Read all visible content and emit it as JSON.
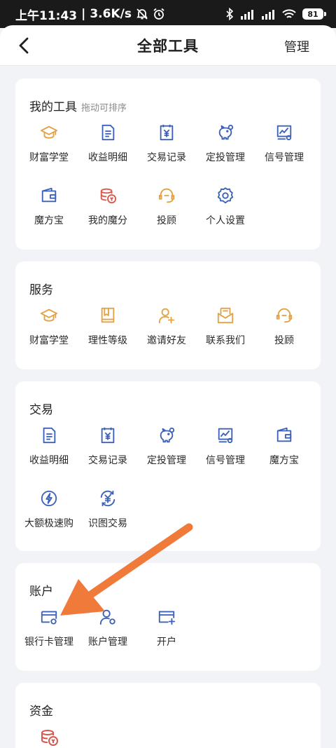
{
  "status_bar": {
    "time": "上午11:43",
    "speed": "3.6K/s",
    "battery": "81"
  },
  "header": {
    "title": "全部工具",
    "manage_label": "管理"
  },
  "sections": [
    {
      "title": "我的工具",
      "subtitle": "拖动可排序",
      "items": [
        {
          "label": "财富学堂",
          "icon": "graduation-cap-icon",
          "color": "#e3a245"
        },
        {
          "label": "收益明细",
          "icon": "document-icon",
          "color": "#3c61b8"
        },
        {
          "label": "交易记录",
          "icon": "yuan-receipt-icon",
          "color": "#3c61b8"
        },
        {
          "label": "定投管理",
          "icon": "piggy-bank-icon",
          "color": "#3c61b8"
        },
        {
          "label": "信号管理",
          "icon": "chart-signal-icon",
          "color": "#3c61b8"
        },
        {
          "label": "魔方宝",
          "icon": "wallet-icon",
          "color": "#3c61b8"
        },
        {
          "label": "我的魔分",
          "icon": "coin-stack-icon",
          "color": "#d9574c"
        },
        {
          "label": "投顾",
          "icon": "headset-icon",
          "color": "#e3a245"
        },
        {
          "label": "个人设置",
          "icon": "gear-icon",
          "color": "#3c61b8"
        }
      ]
    },
    {
      "title": "服务",
      "items": [
        {
          "label": "财富学堂",
          "icon": "graduation-cap-icon",
          "color": "#e3a245"
        },
        {
          "label": "理性等级",
          "icon": "book-icon",
          "color": "#e3a245"
        },
        {
          "label": "邀请好友",
          "icon": "add-user-icon",
          "color": "#e3a245"
        },
        {
          "label": "联系我们",
          "icon": "envelope-icon",
          "color": "#e3a245"
        },
        {
          "label": "投顾",
          "icon": "headset-icon",
          "color": "#e3a245"
        }
      ]
    },
    {
      "title": "交易",
      "items": [
        {
          "label": "收益明细",
          "icon": "document-icon",
          "color": "#3c61b8"
        },
        {
          "label": "交易记录",
          "icon": "yuan-receipt-icon",
          "color": "#3c61b8"
        },
        {
          "label": "定投管理",
          "icon": "piggy-bank-icon",
          "color": "#3c61b8"
        },
        {
          "label": "信号管理",
          "icon": "chart-signal-icon",
          "color": "#3c61b8"
        },
        {
          "label": "魔方宝",
          "icon": "wallet-icon",
          "color": "#3c61b8"
        },
        {
          "label": "大额极速购",
          "icon": "lightning-icon",
          "color": "#3c61b8"
        },
        {
          "label": "识图交易",
          "icon": "yuan-refresh-icon",
          "color": "#3c61b8"
        }
      ]
    },
    {
      "title": "账户",
      "items": [
        {
          "label": "银行卡管理",
          "icon": "bank-card-settings-icon",
          "color": "#3c61b8"
        },
        {
          "label": "账户管理",
          "icon": "user-settings-icon",
          "color": "#3c61b8"
        },
        {
          "label": "开户",
          "icon": "card-add-icon",
          "color": "#3c61b8"
        }
      ]
    },
    {
      "title": "资金",
      "items": [
        {
          "label": "",
          "icon": "coin-stack-icon",
          "color": "#d9574c"
        }
      ]
    }
  ],
  "annotation": {
    "arrow_color": "#f07a3a"
  }
}
